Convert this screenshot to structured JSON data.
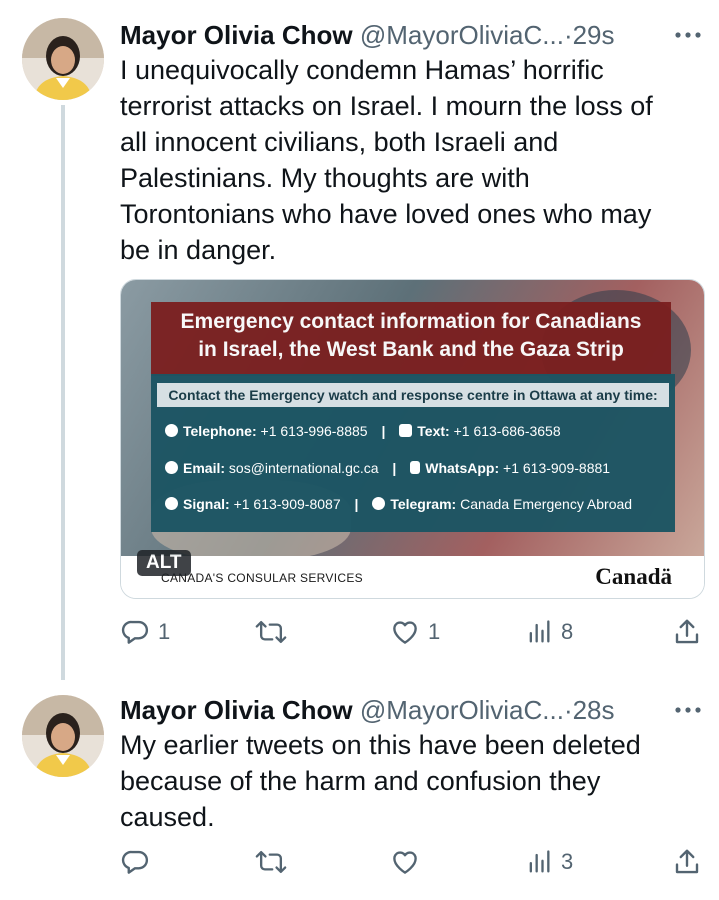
{
  "tweets": [
    {
      "name": "Mayor Olivia Chow",
      "handle": "@MayorOliviaC...",
      "time": "·29s",
      "text": "I unequivocally condemn Hamas’ horrific\nterrorist attacks on Israel. I mourn the loss of\nall innocent civilians, both Israeli and\nPalestinians. My thoughts are with\nTorontonians who have loved ones who may\nbe in danger.",
      "card": {
        "title_line1": "Emergency contact information for Canadians",
        "title_line2": "in Israel, the West Bank and the Gaza Strip",
        "subtitle": "Contact the Emergency watch and response centre in Ottawa at any time:",
        "telephone_label": "Telephone:",
        "telephone": "+1 613-996-8885",
        "text_label": "Text:",
        "text": "+1 613-686-3658",
        "email_label": "Email:",
        "email": "sos@international.gc.ca",
        "whatsapp_label": "WhatsApp:",
        "whatsapp": "+1 613-909-8881",
        "signal_label": "Signal:",
        "signal": "+1 613-909-8087",
        "telegram_label": "Telegram:",
        "telegram": "Canada Emergency Abroad",
        "separator": "|",
        "alt": "ALT",
        "footer_left": "CANADA'S CONSULAR SERVICES",
        "footer_right": "Canadä"
      },
      "replies": "1",
      "retweets": "",
      "likes": "1",
      "views": "8"
    },
    {
      "name": "Mayor Olivia Chow",
      "handle": "@MayorOliviaC...",
      "time": "·28s",
      "text": "My earlier tweets on this have been deleted\nbecause of the harm and confusion they\ncaused.",
      "replies": "",
      "retweets": "",
      "likes": "",
      "views": "3"
    }
  ],
  "icons": {
    "more": "more-dots-icon",
    "reply": "reply-bubble-icon",
    "retweet": "retweet-icon",
    "like": "heart-icon",
    "views": "bar-chart-icon",
    "share": "share-upload-icon"
  },
  "colors": {
    "text_primary": "#0f1419",
    "text_secondary": "#536471",
    "thread_line": "#cfd9de",
    "card_title_bg": "#7b1f1f",
    "card_panel_bg": "#1c5563"
  }
}
